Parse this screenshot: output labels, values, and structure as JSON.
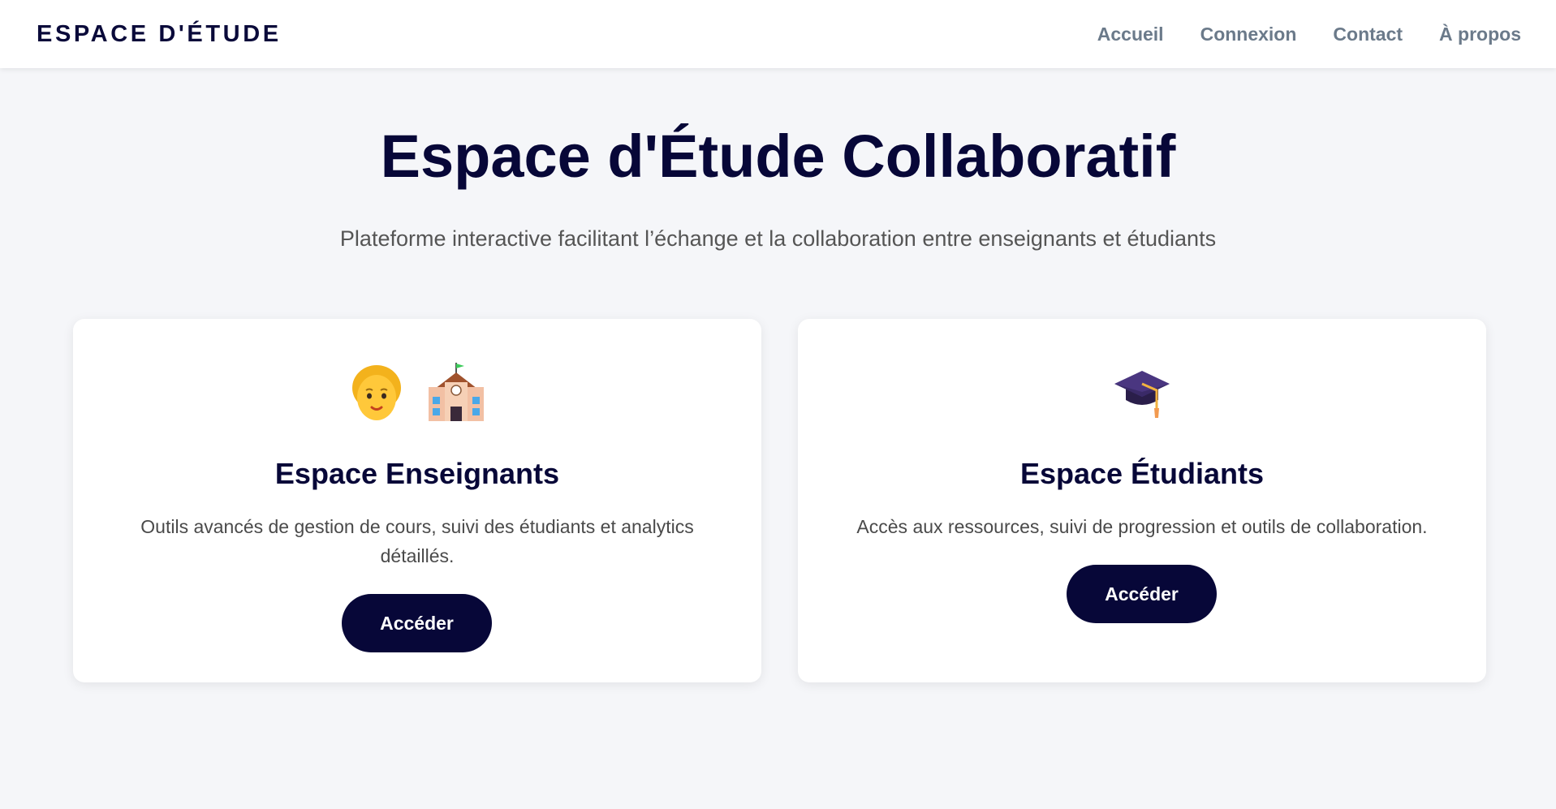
{
  "header": {
    "brand": "ESPACE D'ÉTUDE",
    "nav": [
      "Accueil",
      "Connexion",
      "Contact",
      "À propos"
    ]
  },
  "hero": {
    "title": "Espace d'Étude Collaboratif",
    "subtitle": "Plateforme interactive facilitant l’échange et la collaboration entre enseignants et étudiants"
  },
  "cards": [
    {
      "icons": [
        "teacher-face-icon",
        "school-building-icon"
      ],
      "title": "Espace Enseignants",
      "description": "Outils avancés de gestion de cours, suivi des étudiants et analytics détaillés.",
      "button": "Accéder"
    },
    {
      "icons": [
        "graduation-cap-icon"
      ],
      "title": "Espace Étudiants",
      "description": "Accès aux ressources, suivi de progression et outils de collaboration.",
      "button": "Accéder"
    }
  ],
  "colors": {
    "primary": "#070738",
    "background": "#f5f6f9",
    "nav_link": "#6b7a8a",
    "text_muted": "#555555"
  }
}
